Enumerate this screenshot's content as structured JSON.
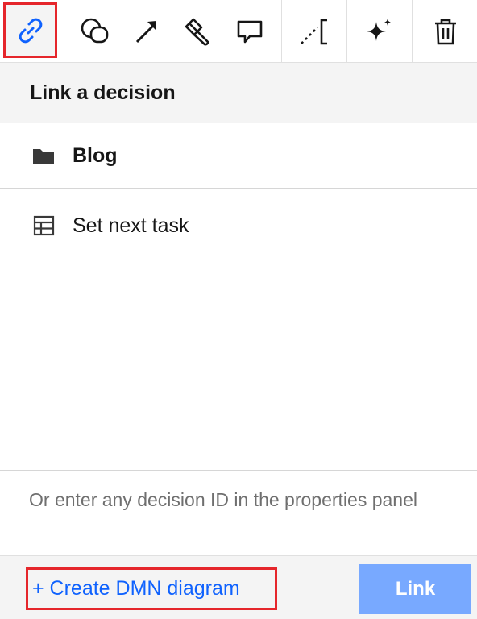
{
  "toolbar": {
    "tools": [
      {
        "name": "link-icon",
        "active": true
      },
      {
        "name": "shapes-icon"
      },
      {
        "name": "connect-arrow-icon"
      },
      {
        "name": "paint-brush-icon"
      },
      {
        "name": "comment-icon"
      },
      {
        "name": "text-annotation-icon"
      },
      {
        "name": "ai-sparkle-icon"
      },
      {
        "name": "trash-icon"
      }
    ]
  },
  "panel": {
    "title": "Link a decision",
    "folder": {
      "label": "Blog",
      "icon": "folder-icon"
    },
    "decisions": [
      {
        "label": "Set next task",
        "icon": "table-icon"
      }
    ],
    "hint": "Or enter any decision ID in the properties panel",
    "create_label": "+ Create DMN diagram",
    "link_label": "Link"
  },
  "colors": {
    "accent": "#0f62fe",
    "link_button": "#78a9ff",
    "highlight": "#e5262b",
    "header_bg": "#f4f4f4"
  }
}
